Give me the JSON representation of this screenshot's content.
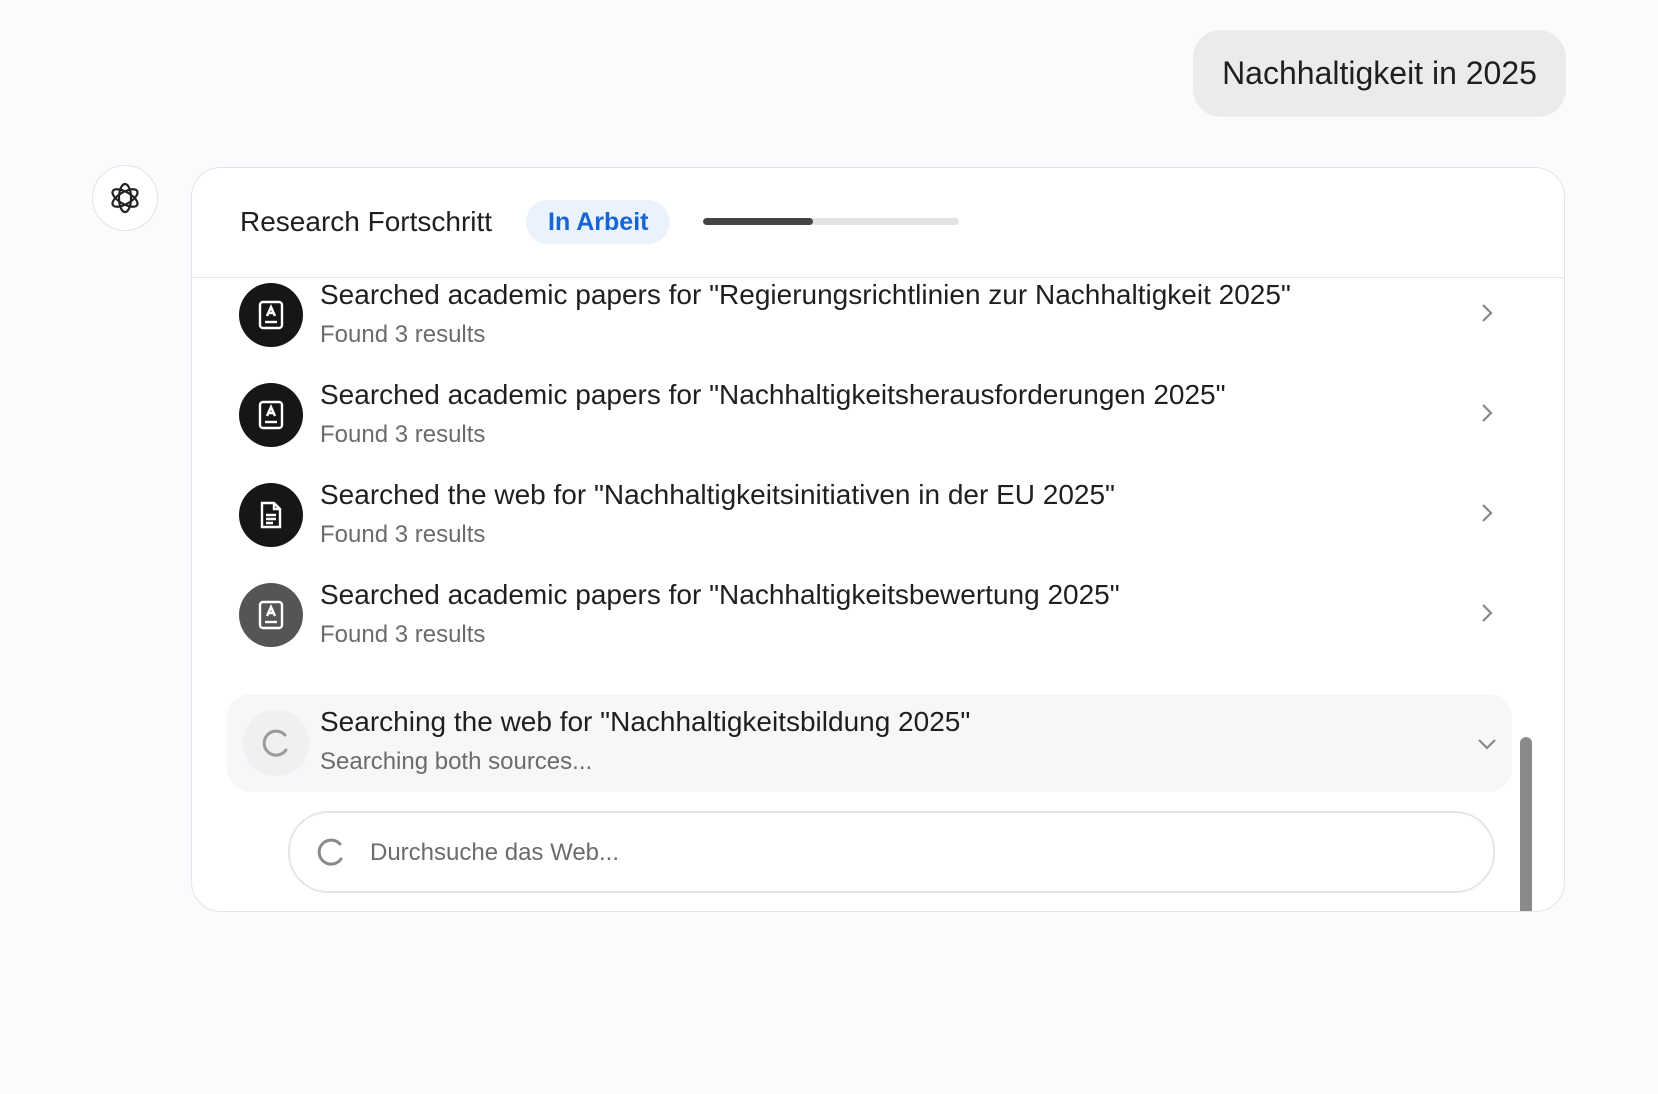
{
  "user_message": "Nachhaltigkeit in 2025",
  "research": {
    "title": "Research Fortschritt",
    "status": "In Arbeit",
    "progress": 0.43,
    "steps": [
      {
        "title": "Searched academic papers for \"Regierungsrichtlinien zur Nachhaltigkeit 2025\"",
        "sub": "Found 3 results",
        "icon": "academic-paper-icon"
      },
      {
        "title": "Searched academic papers for \"Nachhaltigkeitsherausforderungen 2025\"",
        "sub": "Found 3 results",
        "icon": "academic-paper-icon"
      },
      {
        "title": "Searched the web for \"Nachhaltigkeitsinitiativen in der EU 2025\"",
        "sub": "Found 3 results",
        "icon": "web-document-icon"
      },
      {
        "title": "Searched academic papers for \"Nachhaltigkeitsbewertung 2025\"",
        "sub": "Found 3 results",
        "icon": "academic-paper-icon"
      }
    ],
    "active_step": {
      "title": "Searching the web for \"Nachhaltigkeitsbildung 2025\"",
      "sub": "Searching both sources...",
      "icon": "spinner-icon"
    },
    "web_search_placeholder": "Durchsuche das Web..."
  },
  "colors": {
    "badge_text": "#1565d8",
    "badge_bg": "#eaf2fc",
    "icon_bg": "#161616"
  }
}
